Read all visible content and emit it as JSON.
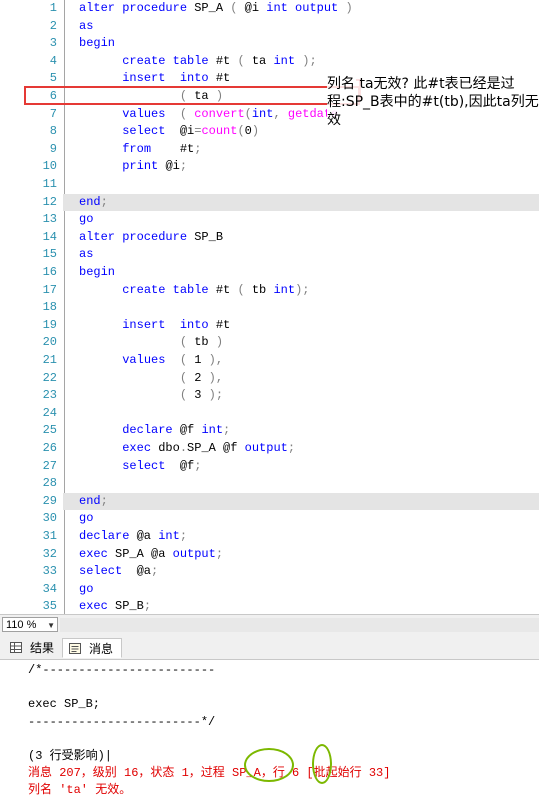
{
  "editor": {
    "lines": [
      {
        "n": "1",
        "t": [
          [
            "kw",
            "alter procedure "
          ],
          [
            "tx",
            "SP_A "
          ],
          [
            "pn",
            "( "
          ],
          [
            "tx",
            "@i "
          ],
          [
            "kw",
            "int output "
          ],
          [
            "pn",
            ")"
          ]
        ]
      },
      {
        "n": "2",
        "t": [
          [
            "kw",
            "as"
          ]
        ]
      },
      {
        "n": "3",
        "t": [
          [
            "kw",
            "begin"
          ]
        ]
      },
      {
        "n": "4",
        "t": [
          [
            "tx",
            "      "
          ],
          [
            "kw",
            "create table "
          ],
          [
            "tx",
            "#t "
          ],
          [
            "pn",
            "( "
          ],
          [
            "tx",
            "ta "
          ],
          [
            "kw",
            "int"
          ],
          [
            "pn",
            " );"
          ]
        ]
      },
      {
        "n": "5",
        "t": [
          [
            "tx",
            "      "
          ],
          [
            "kw",
            "insert  into "
          ],
          [
            "tx",
            "#t"
          ]
        ]
      },
      {
        "n": "6",
        "t": [
          [
            "tx",
            "              "
          ],
          [
            "pn",
            "( "
          ],
          [
            "tx",
            "ta "
          ],
          [
            "pn",
            ")"
          ]
        ]
      },
      {
        "n": "7",
        "t": [
          [
            "tx",
            "      "
          ],
          [
            "kw",
            "values  "
          ],
          [
            "pn",
            "( "
          ],
          [
            "fn",
            "convert"
          ],
          [
            "pn",
            "("
          ],
          [
            "kw",
            "int"
          ],
          [
            "pn",
            ", "
          ],
          [
            "fn",
            "getdate"
          ]
        ]
      },
      {
        "n": "8",
        "t": [
          [
            "tx",
            "      "
          ],
          [
            "kw",
            "select  "
          ],
          [
            "tx",
            "@i"
          ],
          [
            "pn",
            "="
          ],
          [
            "fn",
            "count"
          ],
          [
            "pn",
            "("
          ],
          [
            "tx",
            "0"
          ],
          [
            "pn",
            ")"
          ]
        ]
      },
      {
        "n": "9",
        "t": [
          [
            "tx",
            "      "
          ],
          [
            "kw",
            "from    "
          ],
          [
            "tx",
            "#t"
          ],
          [
            "pn",
            ";"
          ]
        ]
      },
      {
        "n": "10",
        "t": [
          [
            "tx",
            "      "
          ],
          [
            "kw",
            "print "
          ],
          [
            "tx",
            "@i"
          ],
          [
            "pn",
            ";"
          ]
        ]
      },
      {
        "n": "11",
        "t": []
      },
      {
        "n": "12",
        "t": [
          [
            "kw",
            "end"
          ],
          [
            "pn",
            ";"
          ]
        ]
      },
      {
        "n": "13",
        "t": [
          [
            "kw",
            "go"
          ]
        ]
      },
      {
        "n": "14",
        "t": [
          [
            "kw",
            "alter procedure "
          ],
          [
            "tx",
            "SP_B"
          ]
        ]
      },
      {
        "n": "15",
        "t": [
          [
            "kw",
            "as"
          ]
        ]
      },
      {
        "n": "16",
        "t": [
          [
            "kw",
            "begin"
          ]
        ]
      },
      {
        "n": "17",
        "t": [
          [
            "tx",
            "      "
          ],
          [
            "kw",
            "create table "
          ],
          [
            "tx",
            "#t "
          ],
          [
            "pn",
            "( "
          ],
          [
            "tx",
            "tb "
          ],
          [
            "kw",
            "int"
          ],
          [
            "pn",
            ");"
          ]
        ]
      },
      {
        "n": "18",
        "t": []
      },
      {
        "n": "19",
        "t": [
          [
            "tx",
            "      "
          ],
          [
            "kw",
            "insert  into "
          ],
          [
            "tx",
            "#t"
          ]
        ]
      },
      {
        "n": "20",
        "t": [
          [
            "tx",
            "              "
          ],
          [
            "pn",
            "( "
          ],
          [
            "tx",
            "tb "
          ],
          [
            "pn",
            ")"
          ]
        ]
      },
      {
        "n": "21",
        "t": [
          [
            "tx",
            "      "
          ],
          [
            "kw",
            "values  "
          ],
          [
            "pn",
            "( "
          ],
          [
            "tx",
            "1 "
          ],
          [
            "pn",
            "),"
          ]
        ]
      },
      {
        "n": "22",
        "t": [
          [
            "tx",
            "              "
          ],
          [
            "pn",
            "( "
          ],
          [
            "tx",
            "2 "
          ],
          [
            "pn",
            "),"
          ]
        ]
      },
      {
        "n": "23",
        "t": [
          [
            "tx",
            "              "
          ],
          [
            "pn",
            "( "
          ],
          [
            "tx",
            "3 "
          ],
          [
            "pn",
            ");"
          ]
        ]
      },
      {
        "n": "24",
        "t": []
      },
      {
        "n": "25",
        "t": [
          [
            "tx",
            "      "
          ],
          [
            "kw",
            "declare "
          ],
          [
            "tx",
            "@f "
          ],
          [
            "kw",
            "int"
          ],
          [
            "pn",
            ";"
          ]
        ]
      },
      {
        "n": "26",
        "t": [
          [
            "tx",
            "      "
          ],
          [
            "kw",
            "exec "
          ],
          [
            "tx",
            "dbo"
          ],
          [
            "pn",
            "."
          ],
          [
            "tx",
            "SP_A @f "
          ],
          [
            "kw",
            "output"
          ],
          [
            "pn",
            ";"
          ]
        ]
      },
      {
        "n": "27",
        "t": [
          [
            "tx",
            "      "
          ],
          [
            "kw",
            "select  "
          ],
          [
            "tx",
            "@f"
          ],
          [
            "pn",
            ";"
          ]
        ]
      },
      {
        "n": "28",
        "t": []
      },
      {
        "n": "29",
        "t": [
          [
            "kw",
            "end"
          ],
          [
            "pn",
            ";"
          ]
        ]
      },
      {
        "n": "30",
        "t": [
          [
            "kw",
            "go"
          ]
        ]
      },
      {
        "n": "31",
        "t": [
          [
            "kw",
            "declare "
          ],
          [
            "tx",
            "@a "
          ],
          [
            "kw",
            "int"
          ],
          [
            "pn",
            ";"
          ]
        ]
      },
      {
        "n": "32",
        "t": [
          [
            "kw",
            "exec "
          ],
          [
            "tx",
            "SP_A @a "
          ],
          [
            "kw",
            "output"
          ],
          [
            "pn",
            ";"
          ]
        ]
      },
      {
        "n": "33",
        "t": [
          [
            "kw",
            "select  "
          ],
          [
            "tx",
            "@a"
          ],
          [
            "pn",
            ";"
          ]
        ]
      },
      {
        "n": "34",
        "t": [
          [
            "kw",
            "go"
          ]
        ]
      },
      {
        "n": "35",
        "t": [
          [
            "kw",
            "exec "
          ],
          [
            "tx",
            "SP_B"
          ],
          [
            "pn",
            ";"
          ]
        ]
      }
    ]
  },
  "annotation": {
    "note": "列名 ta无效? 此#t表已经是过程:SP_B表中的#t(tb),因此ta列无效"
  },
  "zoom": {
    "value": "110 %"
  },
  "tabs": {
    "results": "结果",
    "messages": "消息"
  },
  "messages": {
    "lines": [
      {
        "cls": "",
        "text": "/*------------------------"
      },
      {
        "cls": "",
        "text": ""
      },
      {
        "cls": "",
        "text": "exec SP_B;"
      },
      {
        "cls": "",
        "text": "------------------------*/"
      },
      {
        "cls": "",
        "text": ""
      },
      {
        "cls": "",
        "text": "(3 行受影响)|"
      },
      {
        "cls": "err",
        "text": "消息 207，级别 16，状态 1，过程 SP_A，行 6 [批起始行 33]"
      },
      {
        "cls": "err",
        "text": "列名 'ta' 无效。"
      }
    ]
  },
  "colors": {
    "keyword": "#0000ff",
    "function": "#ff00ff",
    "line_number": "#2b91af",
    "error": "#e00000",
    "callout": "#e53935",
    "circle": "#7cb800"
  }
}
